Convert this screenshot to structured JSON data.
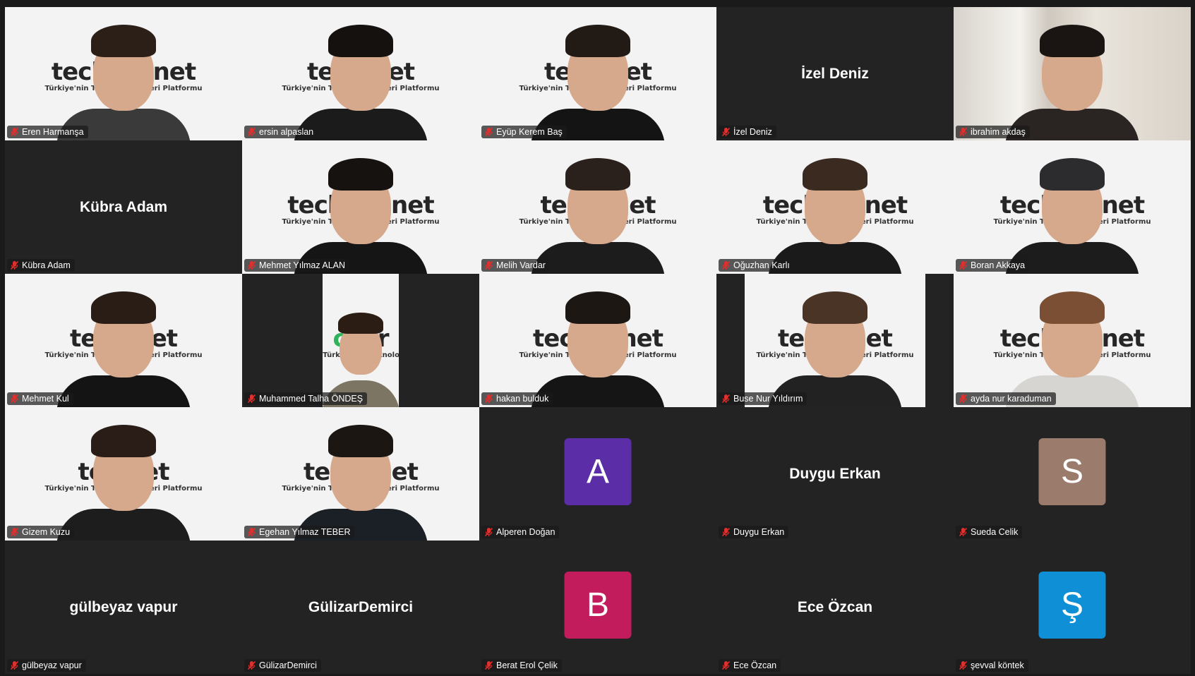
{
  "meeting": {
    "participants": [
      {
        "name": "Eren Harmanşa",
        "video": true,
        "layout": "full",
        "hair": "#2b1f18",
        "shirt": "#3a3a3a",
        "bg_text": [
          "tech",
          "c",
          "er.net"
        ]
      },
      {
        "name": "ersin alpaslan",
        "video": true,
        "layout": "full",
        "hair": "#15110f",
        "shirt": "#1b1b1b",
        "bg_text": [
          "tech",
          "",
          ".net"
        ]
      },
      {
        "name": "Eyüp Kerem Baş",
        "video": true,
        "layout": "full",
        "hair": "#221a14",
        "shirt": "#141414",
        "bg_text": [
          "tech",
          "",
          ".net"
        ]
      },
      {
        "name": "İzel Deniz",
        "video": false,
        "display": "name"
      },
      {
        "name": "ibrahim akdaş",
        "video": true,
        "layout": "room",
        "hair": "#1a1512",
        "shirt": "#2a2422"
      },
      {
        "name": "Kübra Adam",
        "video": false,
        "display": "name"
      },
      {
        "name": "Mehmet Yılmaz ALAN",
        "video": true,
        "layout": "full",
        "hair": "#161210",
        "shirt": "#151515",
        "bg_text": [
          "tech",
          "",
          "eer.net"
        ]
      },
      {
        "name": "Melih Vardar",
        "video": true,
        "layout": "full",
        "hair": "#2a211c",
        "shirt": "#1c1c1c",
        "bg_text": [
          "tech",
          "",
          "r.net"
        ]
      },
      {
        "name": "Oğuzhan Karlı",
        "video": true,
        "layout": "full",
        "hair": "#3a2a20",
        "shirt": "#1a1a1a",
        "bg_text": [
          "tech",
          "c",
          "er.net"
        ]
      },
      {
        "name": "Boran Akkaya",
        "video": true,
        "layout": "full",
        "hair": "#2c2c2e",
        "shirt": "#1c1c1c",
        "bg_text": [
          "tech",
          "c",
          "er.net"
        ]
      },
      {
        "name": "Mehmet Kul",
        "video": true,
        "layout": "full",
        "hair": "#2a1d16",
        "shirt": "#141414",
        "bg_text": [
          "tech",
          "",
          ".net"
        ]
      },
      {
        "name": "Muhammed Talha ÖNDEŞ",
        "video": true,
        "layout": "narrow",
        "hair": "#2b1d14",
        "shirt": "#7c7564",
        "bg_text": [
          "",
          "ca",
          "er"
        ]
      },
      {
        "name": "hakan bulduk",
        "video": true,
        "layout": "full",
        "hair": "#1d1713",
        "shirt": "#151515",
        "bg_text": [
          "tec",
          "",
          "eer.net"
        ]
      },
      {
        "name": "Buse Nur Yıldırım",
        "video": true,
        "layout": "wide",
        "hair": "#4a3426",
        "shirt": "#222222",
        "bg_text": [
          "tec",
          "",
          "er.net"
        ]
      },
      {
        "name": "ayda nur karaduman",
        "video": true,
        "layout": "full",
        "hair": "#7a4f33",
        "shirt": "#d7d5d2",
        "bg_text": [
          "tech",
          "c",
          "er.net"
        ]
      },
      {
        "name": "Gizem Kuzu",
        "video": true,
        "layout": "full",
        "hair": "#2a1c16",
        "shirt": "#1d1d1d",
        "bg_text": [
          "tec",
          "",
          ".net"
        ]
      },
      {
        "name": "Egehan Yılmaz TEBER",
        "video": true,
        "layout": "full",
        "hair": "#1c1613",
        "shirt": "#1b1f26",
        "bg_text": [
          "tec",
          "",
          "er.net"
        ]
      },
      {
        "name": "Alperen Doğan",
        "video": false,
        "display": "avatar",
        "initial": "A",
        "color": "#5b2ea8"
      },
      {
        "name": "Duygu Erkan",
        "video": false,
        "display": "name"
      },
      {
        "name": "Sueda Celik",
        "video": false,
        "display": "avatar",
        "initial": "S",
        "color": "#9b7b6b"
      },
      {
        "name": "gülbeyaz vapur",
        "video": false,
        "display": "name"
      },
      {
        "name": "GülizarDemirci",
        "video": false,
        "display": "name"
      },
      {
        "name": "Berat Erol Çelik",
        "video": false,
        "display": "avatar",
        "initial": "B",
        "color": "#c21c5c"
      },
      {
        "name": "Ece Özcan",
        "video": false,
        "display": "name"
      },
      {
        "name": "şevval köntek",
        "video": false,
        "display": "avatar",
        "initial": "Ş",
        "color": "#0e8fd6"
      }
    ],
    "background_tagline": "Türkiye'nin Teknoloji Kariyeri Platformu",
    "mute_icon": "microphone-muted-icon",
    "mute_color": "#e02f2f"
  }
}
